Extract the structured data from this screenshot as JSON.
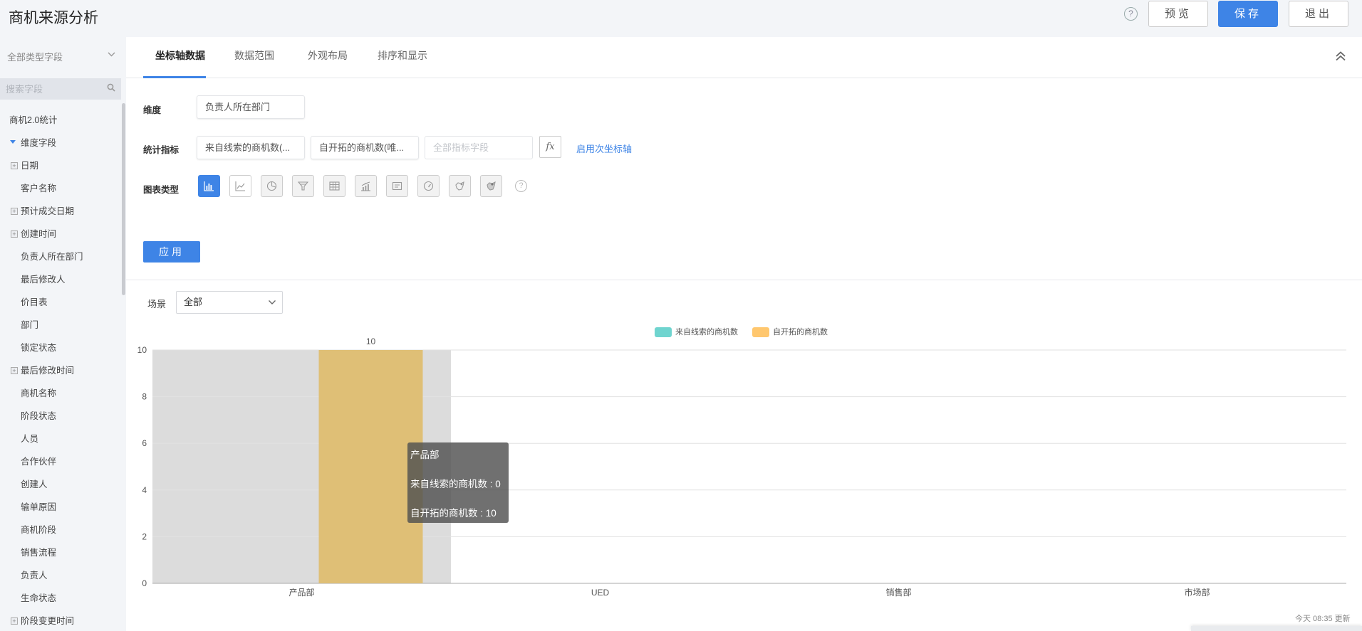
{
  "header": {
    "title": "商机来源分析",
    "help": "?",
    "preview_label": "预览",
    "save_label": "保存",
    "exit_label": "退出"
  },
  "sidebar": {
    "type_select": "全部类型字段",
    "search_placeholder": "搜索字段",
    "items": [
      {
        "label": "商机2.0统计",
        "kind": "root"
      },
      {
        "label": "维度字段",
        "kind": "group"
      },
      {
        "label": "日期",
        "kind": "expandable"
      },
      {
        "label": "客户名称",
        "kind": "leaf"
      },
      {
        "label": "预计成交日期",
        "kind": "expandable"
      },
      {
        "label": "创建时间",
        "kind": "expandable"
      },
      {
        "label": "负责人所在部门",
        "kind": "leaf"
      },
      {
        "label": "最后修改人",
        "kind": "leaf"
      },
      {
        "label": "价目表",
        "kind": "leaf"
      },
      {
        "label": "部门",
        "kind": "leaf"
      },
      {
        "label": "锁定状态",
        "kind": "leaf"
      },
      {
        "label": "最后修改时间",
        "kind": "expandable"
      },
      {
        "label": "商机名称",
        "kind": "leaf"
      },
      {
        "label": "阶段状态",
        "kind": "leaf"
      },
      {
        "label": "人员",
        "kind": "leaf"
      },
      {
        "label": "合作伙伴",
        "kind": "leaf"
      },
      {
        "label": "创建人",
        "kind": "leaf"
      },
      {
        "label": "输单原因",
        "kind": "leaf"
      },
      {
        "label": "商机阶段",
        "kind": "leaf"
      },
      {
        "label": "销售流程",
        "kind": "leaf"
      },
      {
        "label": "负责人",
        "kind": "leaf"
      },
      {
        "label": "生命状态",
        "kind": "leaf"
      },
      {
        "label": "阶段变更时间",
        "kind": "expandable"
      }
    ]
  },
  "tabs": [
    "坐标轴数据",
    "数据范围",
    "外观布局",
    "排序和显示"
  ],
  "config": {
    "dimension_label": "维度",
    "dimension_value": "负责人所在部门",
    "metric_label": "统计指标",
    "metric_1": "来自线索的商机数(...",
    "metric_2": "自开拓的商机数(唯...",
    "metric_placeholder": "全部指标字段",
    "fx": "fx",
    "secondary_axis_link": "启用次坐标轴",
    "chart_type_label": "图表类型",
    "chart_types": [
      "bar-chart-icon",
      "line-chart-icon",
      "pie-chart-icon",
      "funnel-chart-icon",
      "table-chart-icon",
      "combo-chart-icon",
      "card-chart-icon",
      "gauge-chart-icon",
      "map-chart-icon",
      "map-region-chart-icon"
    ],
    "help": "?",
    "apply_label": "应用"
  },
  "scene": {
    "label": "场景",
    "value": "全部"
  },
  "chart_data": {
    "type": "bar",
    "categories": [
      "产品部",
      "UED",
      "销售部",
      "市场部"
    ],
    "series": [
      {
        "name": "来自线索的商机数",
        "color": "#6fd4cf",
        "values": [
          0,
          0,
          0,
          0
        ]
      },
      {
        "name": "自开拓的商机数",
        "color": "#ffc76e",
        "values": [
          10,
          0,
          0,
          0
        ]
      }
    ],
    "ylim": [
      0,
      10
    ],
    "yticks": [
      0,
      2,
      4,
      6,
      8,
      10
    ],
    "grid": true,
    "legend_position": "top-center",
    "data_labels": [
      "10"
    ],
    "hovered_category": "产品部"
  },
  "tooltip": {
    "title": "产品部",
    "line1": "来自线索的商机数 : 0",
    "line2": "自开拓的商机数 : 10"
  },
  "footer": {
    "update_text": "今天 08:35 更新"
  }
}
